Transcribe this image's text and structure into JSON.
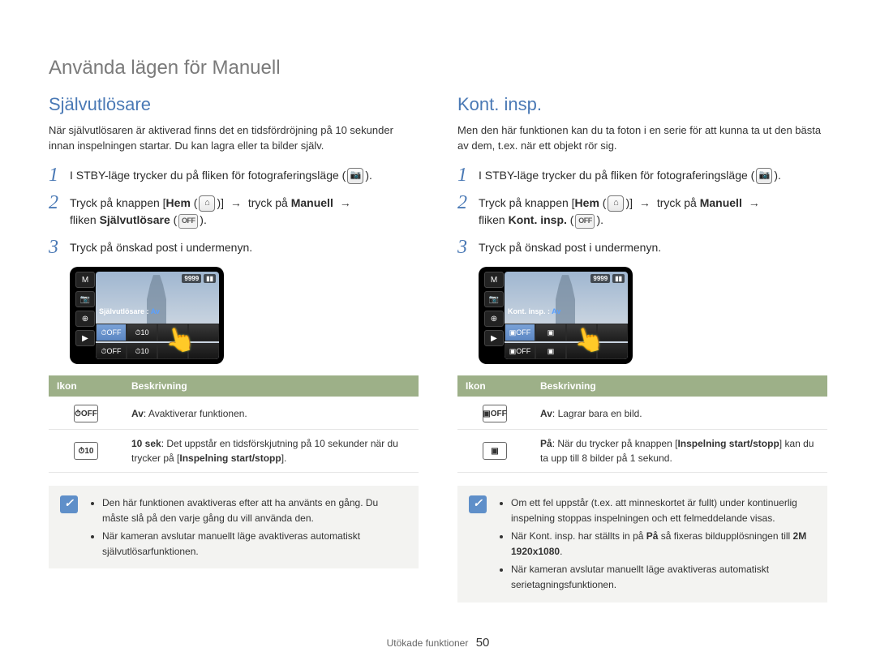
{
  "page": {
    "title": "Använda lägen för Manuell",
    "footer_section": "Utökade funktioner",
    "footer_page": "50"
  },
  "icons": {
    "camera": "📷",
    "home": "⌂",
    "timer_off": "OFF",
    "burst_off": "OFF",
    "arrow": "→",
    "note": "✓"
  },
  "left": {
    "title": "Självutlösare",
    "intro": "När självutlösaren är aktiverad finns det en tidsfördröjning på 10 sekunder innan inspelningen startar. Du kan lagra eller ta bilder själv.",
    "steps": {
      "s1_pre": "I STBY-läge trycker du på fliken för fotograferingsläge (",
      "s1_post": ").",
      "s2_pre": "Tryck på knappen [",
      "s2_home": "Hem",
      "s2_mid1": " (",
      "s2_mid2": ")]",
      "s2_word_press": "tryck på",
      "s2_manual": "Manuell",
      "s2_tab_word": "fliken",
      "s2_tab": "Självutlösare",
      "s2_end": " (",
      "s2_end2": ").",
      "s3": "Tryck på önskad post i undermenyn."
    },
    "cam": {
      "counter": "9999",
      "label": "Självutlösare :",
      "label_val": "Av",
      "strip": [
        "⏱OFF",
        "⏱10",
        "",
        ""
      ],
      "bottom": [
        "⏱OFF",
        "⏱10",
        "",
        ""
      ]
    },
    "table": {
      "h1": "Ikon",
      "h2": "Beskrivning",
      "rows": [
        {
          "icon": "⏱OFF",
          "bold": "Av",
          "text": ": Avaktiverar funktionen."
        },
        {
          "icon": "⏱10",
          "bold": "10 sek",
          "text": ": Det uppstår en tidsförskjutning på 10 sekunder när du trycker på [",
          "bold2": "Inspelning start/stopp",
          "text2": "]."
        }
      ]
    },
    "notes": [
      "Den här funktionen avaktiveras efter att ha använts en gång. Du måste slå på den varje gång du vill använda den.",
      "När kameran avslutar manuellt läge avaktiveras automatiskt självutlösarfunktionen."
    ]
  },
  "right": {
    "title": "Kont. insp.",
    "intro": "Men den här funktionen kan du ta foton i en serie för att kunna ta ut den bästa av dem, t.ex. när ett objekt rör sig.",
    "steps": {
      "s1_pre": "I STBY-läge trycker du på fliken för fotograferingsläge (",
      "s1_post": ").",
      "s2_pre": "Tryck på knappen [",
      "s2_home": "Hem",
      "s2_mid1": " (",
      "s2_mid2": ")]",
      "s2_word_press": "tryck på",
      "s2_manual": "Manuell",
      "s2_tab_word": "fliken",
      "s2_tab": "Kont. insp.",
      "s2_end": " (",
      "s2_end2": ").",
      "s3": "Tryck på önskad post i undermenyn."
    },
    "cam": {
      "counter": "9999",
      "label": "Kont. insp. :",
      "label_val": "Av",
      "strip": [
        "▣OFF",
        "▣",
        "",
        ""
      ],
      "bottom": [
        "▣OFF",
        "▣",
        "",
        ""
      ]
    },
    "table": {
      "h1": "Ikon",
      "h2": "Beskrivning",
      "rows": [
        {
          "icon": "▣OFF",
          "bold": "Av",
          "text": ": Lagrar bara en bild."
        },
        {
          "icon": "▣",
          "bold": "På",
          "text": ": När du trycker på knappen [",
          "bold2": "Inspelning start/stopp",
          "text2": "] kan du ta upp till 8 bilder på 1 sekund."
        }
      ]
    },
    "notes": [
      {
        "plain": "Om ett fel uppstår (t.ex. att minneskortet är fullt) under kontinuerlig inspelning stoppas inspelningen och ett felmeddelande visas."
      },
      {
        "pre": "När Kont. insp. har ställts in på ",
        "b1": "På",
        "mid": " så fixeras bildupplösningen till ",
        "b2": "2M 1920x1080",
        "post": "."
      },
      {
        "plain": "När kameran avslutar manuellt läge avaktiveras automatiskt serietagningsfunktionen."
      }
    ]
  }
}
